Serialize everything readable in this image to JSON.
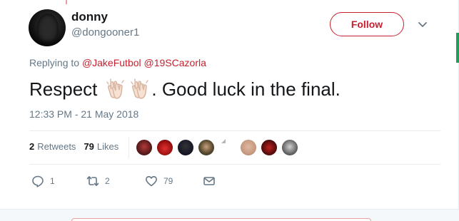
{
  "author": {
    "name": "donny",
    "handle": "@dongooner1"
  },
  "follow_button": {
    "label": "Follow"
  },
  "replying": {
    "prefix": "Replying to",
    "mentions": [
      "@JakeFutbol",
      "@19SCazorla"
    ]
  },
  "tweet": {
    "text_before": "Respect",
    "emoji": [
      "clapping-hands-light-skin",
      "clapping-hands-light-skin"
    ],
    "text_after": ". Good luck in the final."
  },
  "timestamp": "12:33 PM - 21 May 2018",
  "stats": {
    "retweets_count": "2",
    "retweets_label": "Retweets",
    "likes_count": "79",
    "likes_label": "Likes"
  },
  "actions": {
    "reply_count": "1",
    "retweet_count": "2",
    "like_count": "79"
  },
  "colors": {
    "accent": "#c5202f",
    "muted": "#657786",
    "text": "#14171a",
    "divider": "#e6ecf0"
  },
  "icons": [
    "caret-down-icon",
    "reply-icon",
    "retweet-icon",
    "heart-icon",
    "message-icon"
  ]
}
